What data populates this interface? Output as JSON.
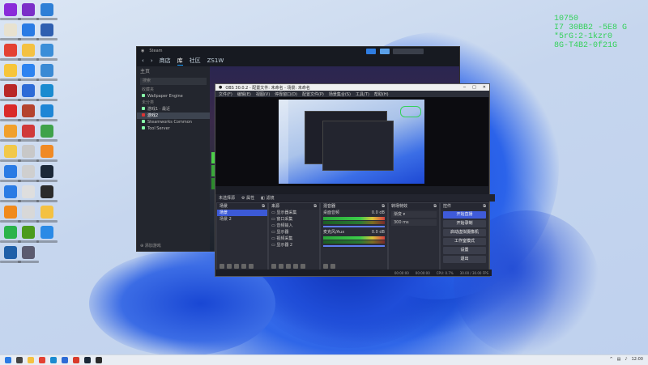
{
  "desktop": {
    "overlay_text": [
      "10750",
      "I7 30BB2 -5E8 G",
      "*5rG:2-1kzr0",
      "8G-T4B2-0f21G"
    ],
    "overlay_color": "#34d15a",
    "icons": [
      {
        "name": "winrar-icon",
        "color": "#8a2bd9"
      },
      {
        "name": "winrar-icon",
        "color": "#7b2fc8"
      },
      {
        "name": "desktop-icon",
        "color": "#2e7fd6"
      },
      {
        "name": "file-icon",
        "color": "#e8e2d0"
      },
      {
        "name": "arrow-app-icon",
        "color": "#2a7be4"
      },
      {
        "name": "app-icon",
        "color": "#2f5fb0"
      },
      {
        "name": "chrome-icon",
        "color": "#e34133"
      },
      {
        "name": "folder-icon",
        "color": "#f4c142"
      },
      {
        "name": "recycle-bin-icon",
        "color": "#3b8ed8"
      },
      {
        "name": "app-icon",
        "color": "#f6c53b"
      },
      {
        "name": "messenger-icon",
        "color": "#2d83f0"
      },
      {
        "name": "network-icon",
        "color": "#3a8ad4"
      },
      {
        "name": "app-icon",
        "color": "#b82828"
      },
      {
        "name": "app-icon",
        "color": "#2d6bd6"
      },
      {
        "name": "edge-icon",
        "color": "#1a8bd0"
      },
      {
        "name": "netease-icon",
        "color": "#d92a2a"
      },
      {
        "name": "app-icon",
        "color": "#b4432e"
      },
      {
        "name": "app-icon",
        "color": "#1e86d6"
      },
      {
        "name": "app-icon",
        "color": "#f0a02c"
      },
      {
        "name": "app-icon",
        "color": "#d03a3a"
      },
      {
        "name": "globe-icon",
        "color": "#3fa24a"
      },
      {
        "name": "app-icon",
        "color": "#f1c84a"
      },
      {
        "name": "file-icon",
        "color": "#c8c8c8"
      },
      {
        "name": "app-icon",
        "color": "#f08a24"
      },
      {
        "name": "arrow-app-icon",
        "color": "#2a7be4"
      },
      {
        "name": "file-icon",
        "color": "#cfcfcf"
      },
      {
        "name": "steam-icon",
        "color": "#1b2838"
      },
      {
        "name": "arrow-app-icon",
        "color": "#2a7be4"
      },
      {
        "name": "file-icon",
        "color": "#dedede"
      },
      {
        "name": "obs-icon",
        "color": "#2b2b2b"
      },
      {
        "name": "vlc-icon",
        "color": "#f08a1c"
      },
      {
        "name": "file-icon",
        "color": "#d8d8d8"
      },
      {
        "name": "folder-icon",
        "color": "#f4c142"
      },
      {
        "name": "wechat-icon",
        "color": "#2ab34b"
      },
      {
        "name": "nvidia-icon",
        "color": "#4b9b1c"
      },
      {
        "name": "app-icon",
        "color": "#2a8ae6"
      },
      {
        "name": "app-icon",
        "color": "#1f5fa8"
      },
      {
        "name": "app-icon",
        "color": "#5b5b70"
      }
    ]
  },
  "steam": {
    "title": "Steam",
    "nav": [
      "商店",
      "库",
      "社区",
      "ZS1W"
    ],
    "sidebar_header": "主页",
    "search_placeholder": "搜索",
    "sections": [
      "收藏夹",
      "未分类"
    ],
    "items": [
      "Wallpaper Engine",
      "游戏1 · 最近",
      "游戏2",
      "Steamworks Common",
      "Tool Server"
    ],
    "footer": "添加游戏"
  },
  "obs": {
    "title": "OBS 30.0.2 - 配置文件: 未命名 - 场景: 未命名",
    "menu": [
      "文件(F)",
      "编辑(E)",
      "视图(V)",
      "停靠窗口(D)",
      "配置文件(P)",
      "场景集合(S)",
      "工具(T)",
      "帮助(H)"
    ],
    "context_bar": [
      "未选择源",
      "属性",
      "滤镜"
    ],
    "scenes_header": "场景",
    "scenes": [
      "场景",
      "场景 2"
    ],
    "sources_header": "来源",
    "sources": [
      "显示器采集",
      "窗口采集",
      "音频输入",
      "显示器",
      "视频采集",
      "显示器 2"
    ],
    "mixer_header": "混音器",
    "mixer": [
      {
        "name": "桌面音频",
        "db": "0.0 dB"
      },
      {
        "name": "麦克风/Aux",
        "db": "0.0 dB"
      }
    ],
    "transitions_header": "转场特效",
    "transition": "渐变",
    "duration": "300 ms",
    "controls_header": "控件",
    "controls": [
      "开始直播",
      "开始录制",
      "启动虚拟摄像机",
      "工作室模式",
      "设置",
      "退出"
    ],
    "status": [
      "00:00:00",
      "00:00:00",
      "CPU: 0.7%",
      "30.00 / 30.00 FPS"
    ]
  },
  "taskbar": {
    "time": "12:00",
    "apps": [
      {
        "name": "windows-start-icon",
        "color": "#2b7be4"
      },
      {
        "name": "search-icon",
        "color": "#444"
      },
      {
        "name": "file-explorer-icon",
        "color": "#f4c142"
      },
      {
        "name": "chrome-icon",
        "color": "#e34133"
      },
      {
        "name": "edge-icon",
        "color": "#1a8bd0"
      },
      {
        "name": "app-icon",
        "color": "#2d6bd6"
      },
      {
        "name": "wps-icon",
        "color": "#d93a2a"
      },
      {
        "name": "steam-icon",
        "color": "#1b2838"
      },
      {
        "name": "obs-icon",
        "color": "#2b2b2b"
      }
    ]
  }
}
